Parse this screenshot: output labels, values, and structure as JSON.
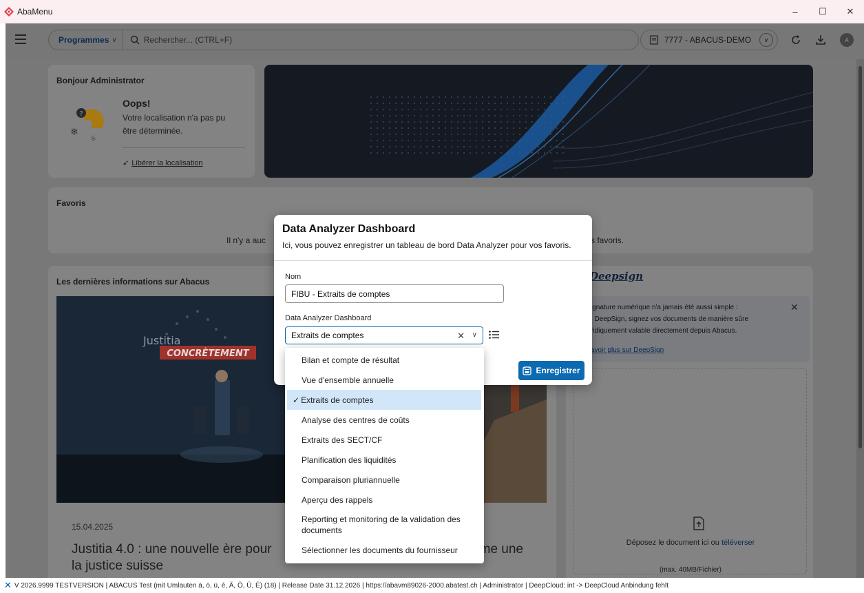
{
  "window": {
    "title": "AbaMenu",
    "minimize": "–",
    "maximize": "☐",
    "close": "✕"
  },
  "appbar": {
    "programs_label": "Programmes",
    "search_placeholder": "Rechercher... (CTRL+F)",
    "mandant": "7777 - ABACUS-DEMO",
    "avatar_initial": "A"
  },
  "weather": {
    "greeting": "Bonjour Administrator",
    "oops": "Oops!",
    "message": "Votre localisation n'a pas pu être déterminée.",
    "link": "Libérer la localisation"
  },
  "favorites": {
    "title": "Favoris",
    "empty_left": "Il n'y a auc",
    "empty_right": "s favoris."
  },
  "news": {
    "title": "Les dernières informations sur Abacus",
    "photo_caption_1": "Justitia",
    "photo_caption_2": "CONCRÈTEMENT",
    "date": "15.04.2025",
    "headline": "Justitia 4.0 : une nouvelle ère pour la justice suisse",
    "headline2": "nts, pour nous, c'est comme une"
  },
  "deepsign": {
    "logo": "Deepsign",
    "line1": "ignature numérique n'a jamais été aussi simple :",
    "line2": ": DeepSign, signez vos documents de manière sûre",
    "line3": "ridiquement valable directement depuis Abacus.",
    "link": "avoir plus sur DeepSign",
    "close": "✕",
    "drop_text": "Déposez le document ici ou",
    "drop_link": "téléverser",
    "drop_max": "(max. 40MB/Fichier)"
  },
  "modal": {
    "title": "Data Analyzer Dashboard",
    "subtitle": "Ici, vous pouvez enregistrer un tableau de bord Data Analyzer pour vos favoris.",
    "name_label": "Nom",
    "name_value": "FIBU - Extraits de comptes",
    "dashboard_label": "Data Analyzer Dashboard",
    "dashboard_value": "Extraits de comptes",
    "save_label": "Enregistrer"
  },
  "dropdown": {
    "check": "✓",
    "options": [
      "Bilan et compte de résultat",
      "Vue d'ensemble annuelle",
      "Extraits de comptes",
      "Analyse des centres de coûts",
      "Extraits des SECT/CF",
      "Planification des liquidités",
      "Comparaison pluriannuelle",
      "Aperçu des rappels",
      "Reporting et monitoring de la validation des documents",
      "Sélectionner les documents du fournisseur"
    ],
    "selected_index": 2
  },
  "statusbar": {
    "text": "V 2026.9999 TESTVERSION | ABACUS Test (mit Umlauten ä, ö, ü, é, Ä, Ö, Ü, É) (18) | Release Date 31.12.2026 | https://abavm89026-2000.abatest.ch | Administrator | DeepCloud: int -> DeepCloud Anbindung fehlt"
  }
}
